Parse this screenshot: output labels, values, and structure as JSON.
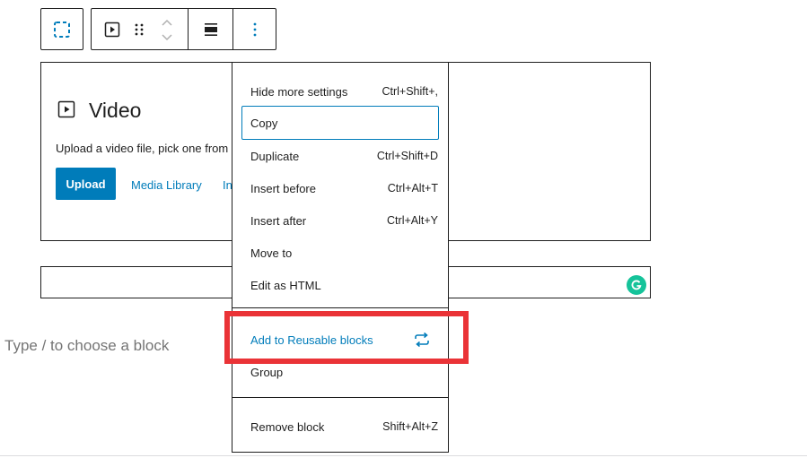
{
  "toolbar": {
    "select_parent_icon": "dashed-square-icon",
    "block_type_icon": "video-play-icon",
    "drag_icon": "drag-handle-icon",
    "move_icon": "chevron-up-down-icon",
    "align_icon": "align-icon",
    "more_icon": "more-vertical-icon"
  },
  "video_block": {
    "title": "Video",
    "description": "Upload a video file, pick one from",
    "upload_label": "Upload",
    "media_library_label": "Media Library",
    "insert_url_label": "In"
  },
  "placeholder": "Type / to choose a block",
  "menu": {
    "items": [
      {
        "label": "Hide more settings",
        "shortcut": "Ctrl+Shift+,"
      },
      {
        "label": "Copy",
        "shortcut": ""
      },
      {
        "label": "Duplicate",
        "shortcut": "Ctrl+Shift+D"
      },
      {
        "label": "Insert before",
        "shortcut": "Ctrl+Alt+T"
      },
      {
        "label": "Insert after",
        "shortcut": "Ctrl+Alt+Y"
      },
      {
        "label": "Move to",
        "shortcut": ""
      },
      {
        "label": "Edit as HTML",
        "shortcut": ""
      },
      {
        "label": "Add to Reusable blocks",
        "icon": "reusable-block-icon"
      },
      {
        "label": "Group",
        "shortcut": ""
      },
      {
        "label": "Remove block",
        "shortcut": "Shift+Alt+Z"
      }
    ]
  },
  "colors": {
    "accent": "#007cba",
    "highlight": "#ea3337",
    "grammarly": "#15c39a"
  }
}
